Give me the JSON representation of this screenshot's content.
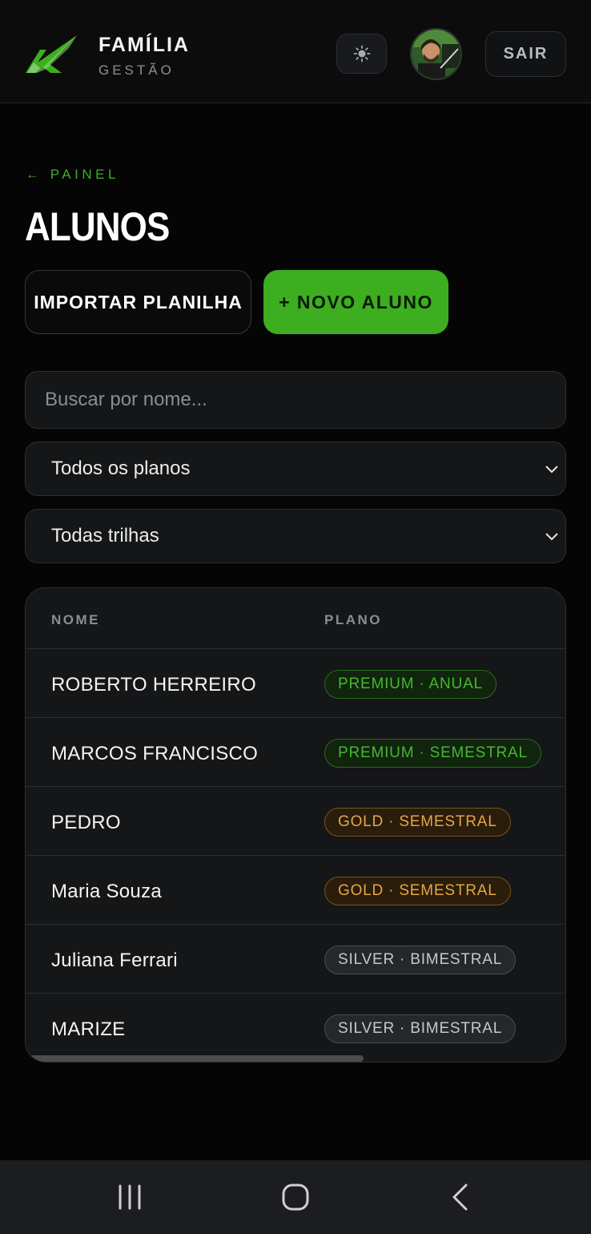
{
  "header": {
    "brand_title": "FAMÍLIA",
    "brand_subtitle": "GESTÃO",
    "theme_icon": "sun-icon",
    "logout_label": "SAIR"
  },
  "breadcrumb": {
    "back_label": "← PAINEL"
  },
  "page": {
    "title": "ALUNOS",
    "import_label": "IMPORTAR PLANILHA",
    "new_label": "+ NOVO ALUNO"
  },
  "filters": {
    "search_placeholder": "Buscar por nome...",
    "plan_selected": "Todos os planos",
    "track_selected": "Todas trilhas"
  },
  "table": {
    "headers": [
      "NOME",
      "PLANO"
    ],
    "rows": [
      {
        "name": "ROBERTO HERREIRO",
        "plan": "PREMIUM · ANUAL",
        "tier": "premium"
      },
      {
        "name": "MARCOS FRANCISCO",
        "plan": "PREMIUM · SEMESTRAL",
        "tier": "premium"
      },
      {
        "name": "PEDRO",
        "plan": "GOLD · SEMESTRAL",
        "tier": "gold"
      },
      {
        "name": "Maria Souza",
        "plan": "GOLD · SEMESTRAL",
        "tier": "gold"
      },
      {
        "name": "Juliana Ferrari",
        "plan": "SILVER · BIMESTRAL",
        "tier": "silver"
      },
      {
        "name": "MARIZE",
        "plan": "SILVER · BIMESTRAL",
        "tier": "silver"
      }
    ]
  },
  "colors": {
    "accent": "#3dae1f",
    "premium_text": "#45b82f",
    "premium_bg": "#10240e",
    "premium_border": "#2c6b20",
    "gold_text": "#e7a641",
    "gold_bg": "#2a1d0b",
    "gold_border": "#7a5419",
    "silver_text": "#c4c7cb",
    "silver_bg": "#25272b",
    "silver_border": "#4a4d52"
  },
  "navbar": {
    "icons": [
      "recent-apps-icon",
      "home-icon",
      "back-icon"
    ]
  }
}
